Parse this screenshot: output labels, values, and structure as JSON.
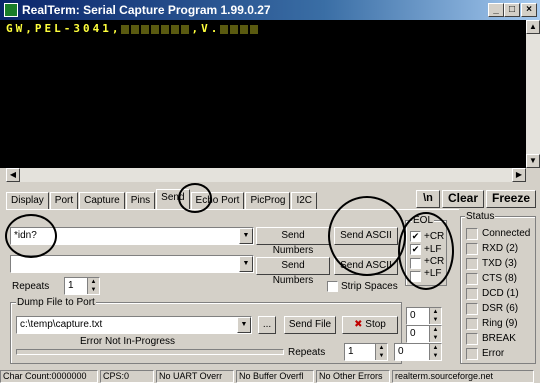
{
  "window": {
    "title": "RealTerm: Serial Capture Program 1.99.0.27"
  },
  "terminal": {
    "visible_text_start": "GW,PEL-3041,",
    "visible_text_mid": ",V."
  },
  "tabs": [
    "Display",
    "Port",
    "Capture",
    "Pins",
    "Send",
    "Echo Port",
    "PicProg",
    "I2C"
  ],
  "active_tab": "Send",
  "toolbar_right": {
    "newline_label": "\\n",
    "clear_label": "Clear",
    "freeze_label": "Freeze"
  },
  "send": {
    "line1_value": "*idn?",
    "line2_value": "",
    "send_numbers_label": "Send Numbers",
    "send_ascii_label": "Send ASCII",
    "send_numbers2_label": "Send Numbers",
    "send_ascii2_label": "Send ASCII",
    "repeats_label": "Repeats",
    "repeats_value": "1",
    "strip_spaces_label": "Strip Spaces"
  },
  "eol": {
    "title": "EOL",
    "items": [
      {
        "label": "+CR",
        "checked": true
      },
      {
        "label": "+LF",
        "checked": true
      },
      {
        "label": "+CR",
        "checked": false
      },
      {
        "label": "+LF",
        "checked": false
      }
    ]
  },
  "dump": {
    "group_label": "Dump File to Port",
    "file_value": "c:\\temp\\capture.txt",
    "browse_label": "...",
    "send_file_label": "Send File",
    "stop_label": "Stop",
    "status_text": "Error Not In-Progress",
    "repeats_label": "Repeats",
    "repeats_value": "1",
    "spin_a": "0",
    "spin_b": "0",
    "spin_c": "0"
  },
  "status": {
    "title": "Status",
    "items": [
      "Connected",
      "RXD (2)",
      "TXD (3)",
      "CTS (8)",
      "DCD (1)",
      "DSR (6)",
      "Ring (9)",
      "BREAK",
      "Error"
    ]
  },
  "statusbar": [
    "Char Count:0000000",
    "CPS:0",
    "No UART Overr",
    "No Buffer Overfl",
    "No Other Errors",
    "realterm.sourceforge.net"
  ]
}
